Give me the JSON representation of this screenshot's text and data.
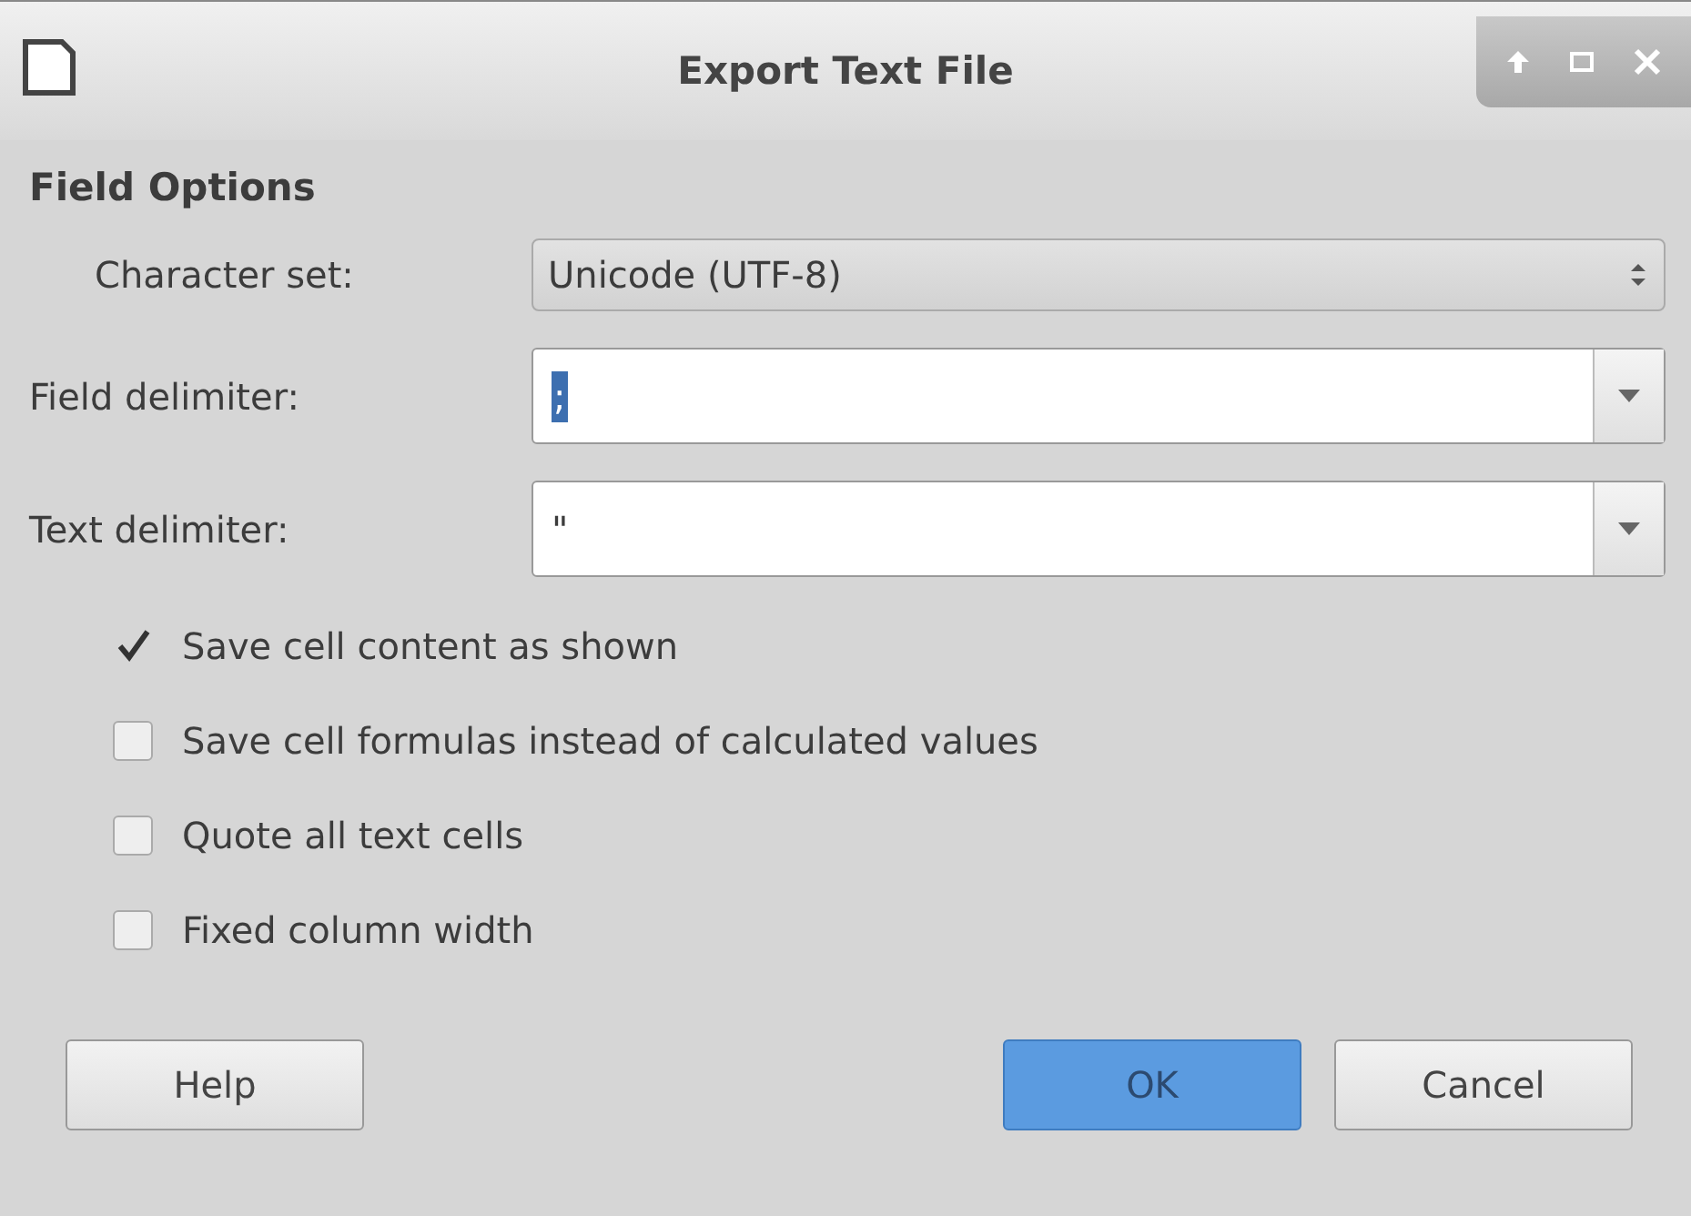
{
  "window": {
    "title": "Export Text File"
  },
  "section": "Field Options",
  "fields": [
    {
      "kind": "spin",
      "label": "Character set:",
      "value": "Unicode (UTF-8)"
    },
    {
      "kind": "combo",
      "label": "Field delimiter:",
      "value": ";",
      "value_selected": true
    },
    {
      "kind": "combo",
      "label": "Text delimiter:",
      "value": "\"",
      "value_selected": false
    }
  ],
  "options": [
    {
      "label": "Save cell content as shown",
      "checked": true
    },
    {
      "label": "Save cell formulas instead of calculated values",
      "checked": false
    },
    {
      "label": "Quote all text cells",
      "checked": false
    },
    {
      "label": "Fixed column width",
      "checked": false
    }
  ],
  "buttons": [
    {
      "label": "Help",
      "kind": "left"
    },
    {
      "label": "OK",
      "kind": "default"
    },
    {
      "label": "Cancel",
      "kind": "normal"
    }
  ]
}
